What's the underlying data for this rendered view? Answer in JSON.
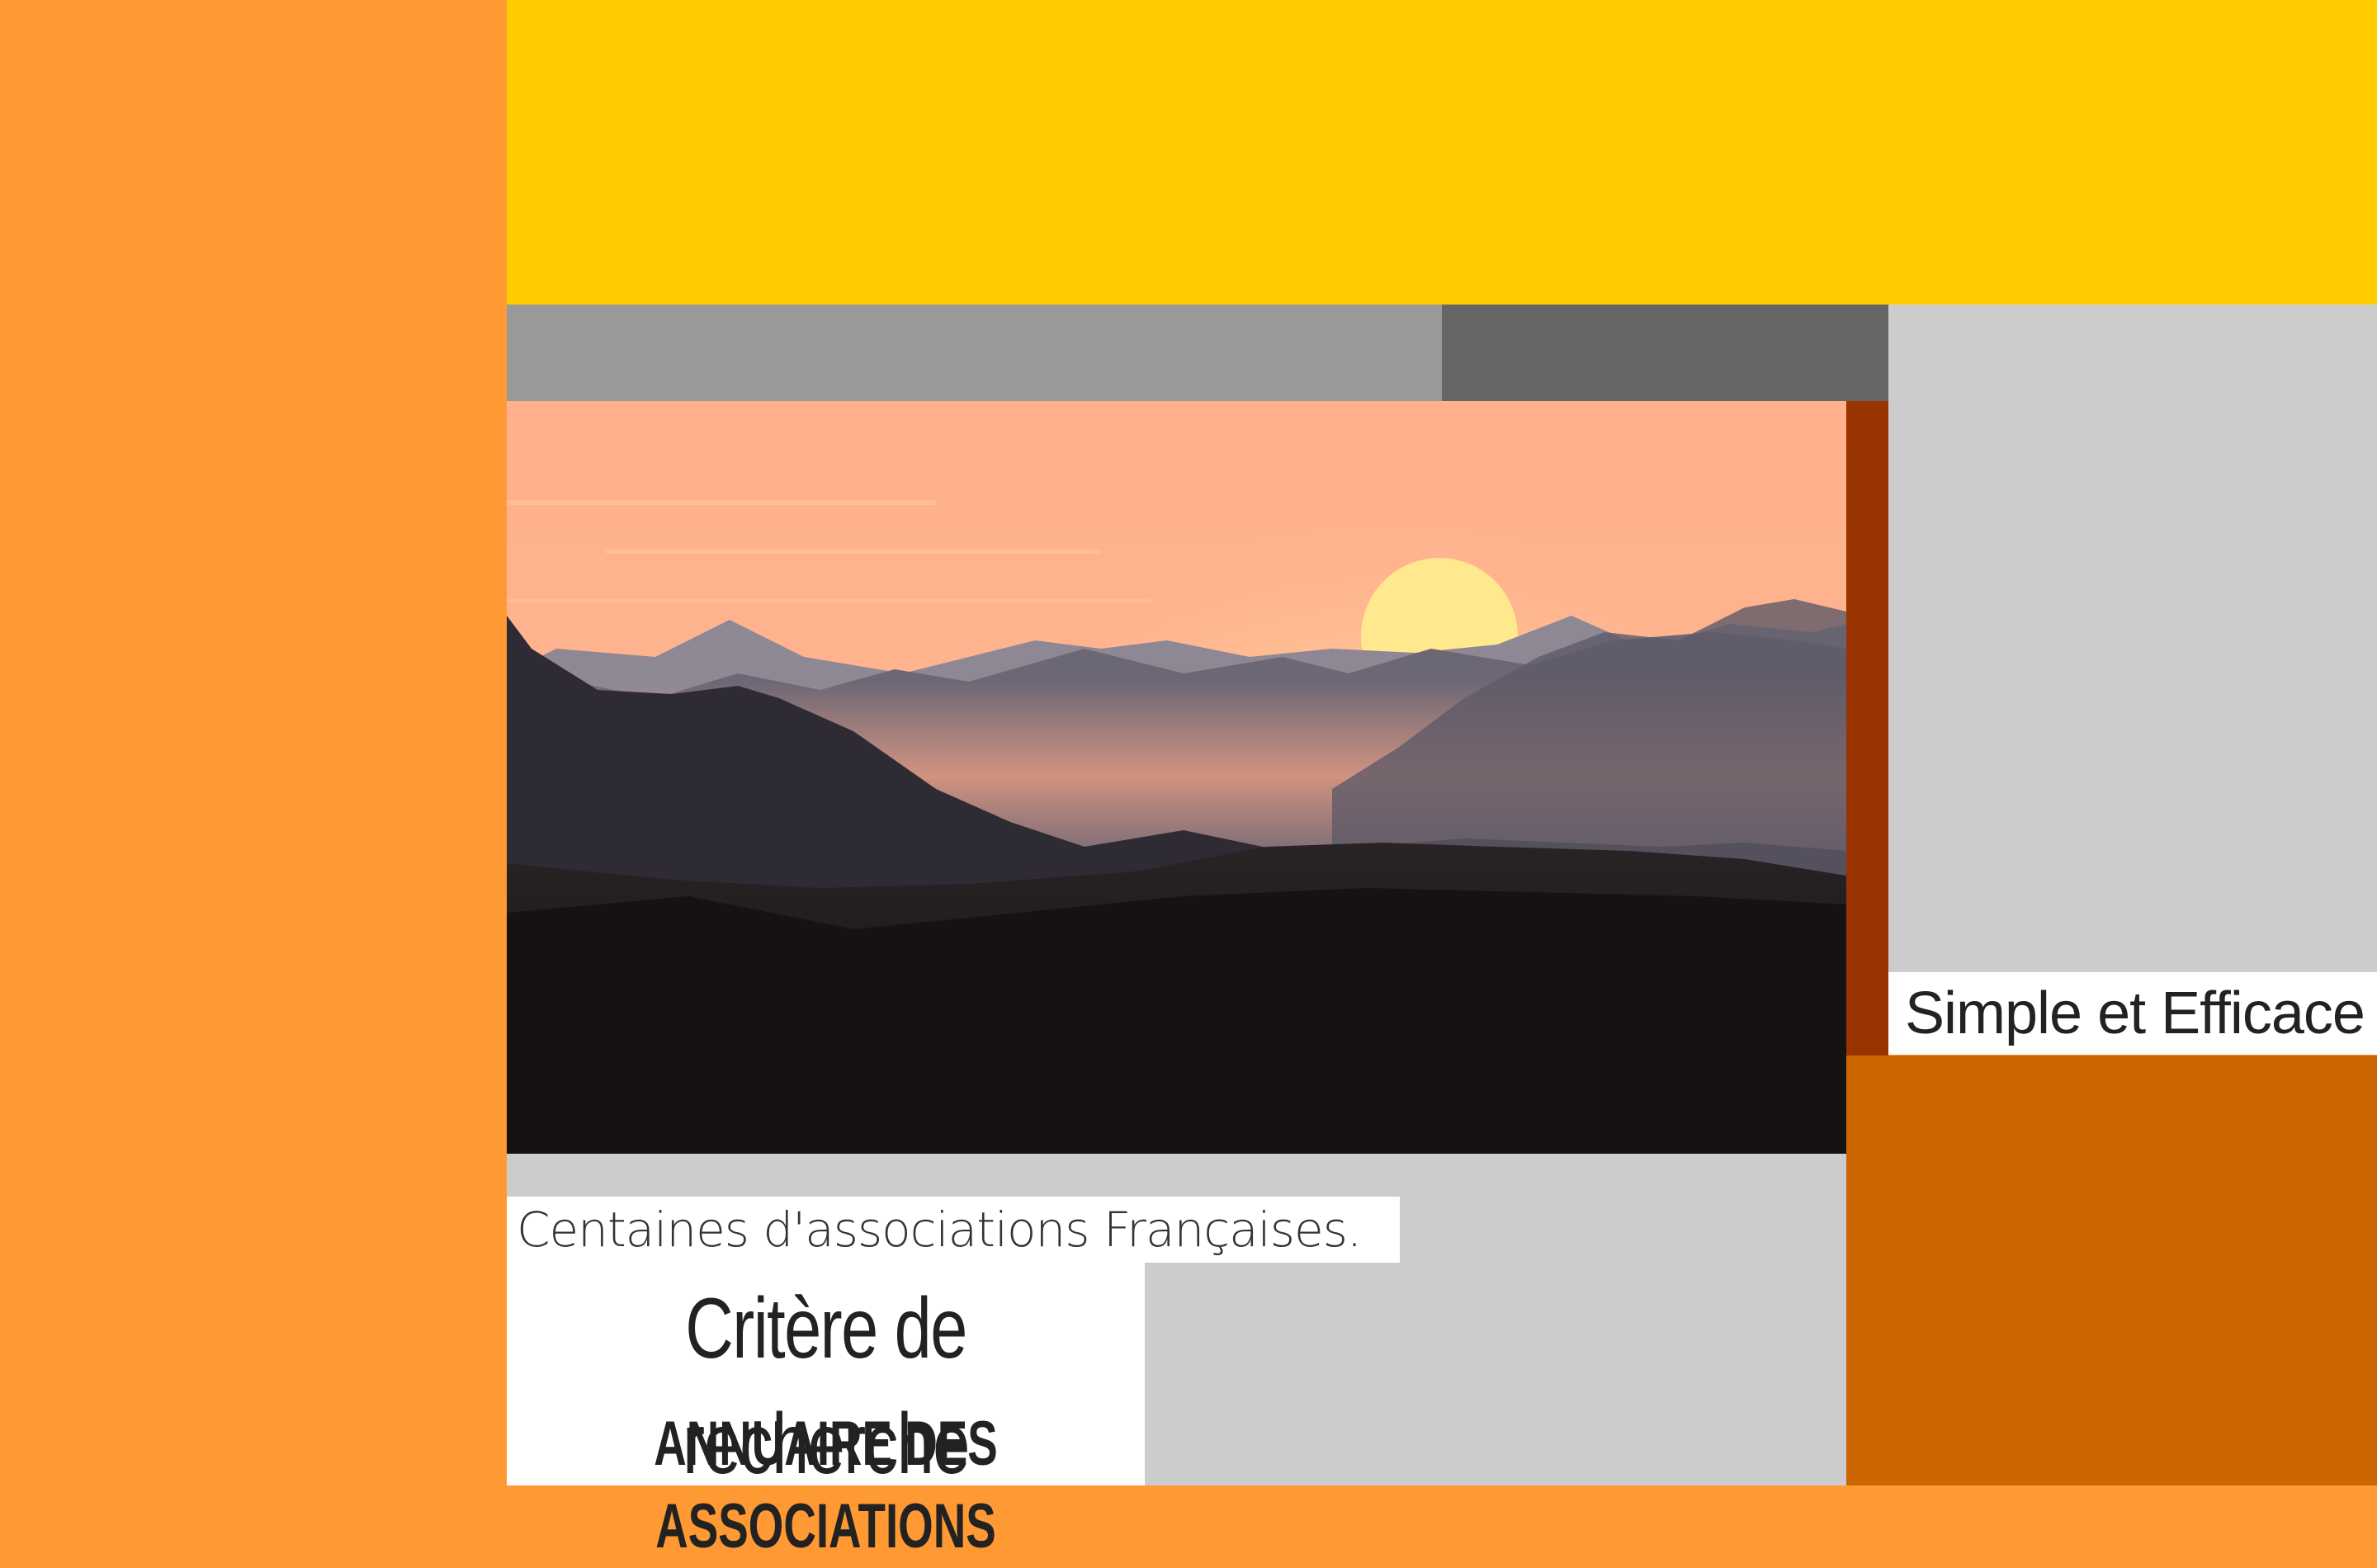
{
  "colors": {
    "page_background": "#ff9933",
    "top_banner": "#ffcc00",
    "nav_bar_left": "#999999",
    "nav_bar_right": "#666666",
    "right_column": "#cccccc",
    "accent_strip": "#993300",
    "lower_right": "#cc6600",
    "content_area": "#cccccc",
    "label_background": "#ffffff"
  },
  "hero": {
    "image": "mountain-sunset-landscape"
  },
  "tagline": "Simple et Efficace",
  "subtitle": "Centaines d'associations Françaises.",
  "search": {
    "title": "Critère de recherche",
    "directory_title": "ANNUAIRE DES ASSOCIATIONS"
  }
}
